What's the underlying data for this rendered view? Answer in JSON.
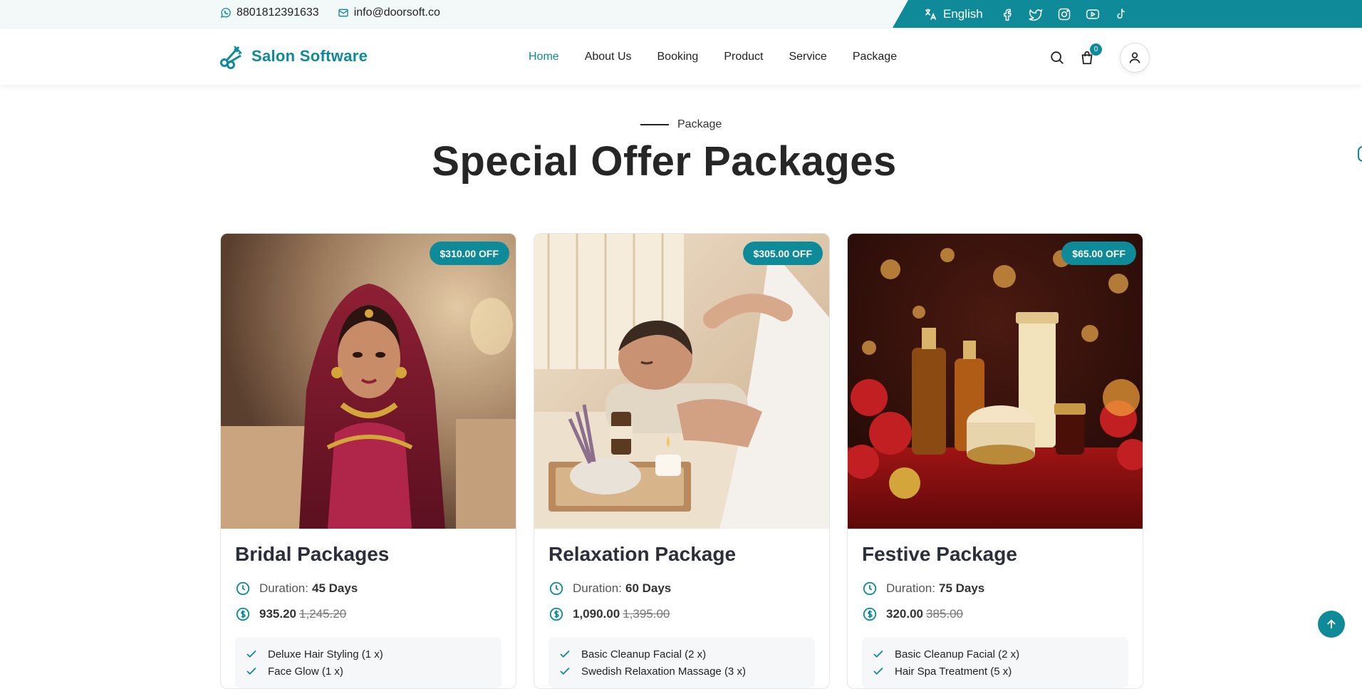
{
  "topbar": {
    "phone": "8801812391633",
    "email": "info@doorsoft.co",
    "language": "English",
    "social_icons": [
      "facebook-icon",
      "twitter-icon",
      "instagram-icon",
      "youtube-icon",
      "tiktok-icon"
    ]
  },
  "header": {
    "logo_text": "Salon Software",
    "nav": [
      {
        "label": "Home",
        "active": true
      },
      {
        "label": "About Us",
        "active": false
      },
      {
        "label": "Booking",
        "active": false
      },
      {
        "label": "Product",
        "active": false
      },
      {
        "label": "Service",
        "active": false
      },
      {
        "label": "Package",
        "active": false
      }
    ],
    "cart_count": "0"
  },
  "section": {
    "label": "Package",
    "title": "Special Offer Packages"
  },
  "packages": [
    {
      "title": "Bridal Packages",
      "badge": "$310.00 OFF",
      "duration_label": "Duration:",
      "duration": "45 Days",
      "price": "935.20",
      "old_price": "1,245.20",
      "features": [
        "Deluxe Hair Styling (1 x)",
        "Face Glow (1 x)"
      ]
    },
    {
      "title": "Relaxation Package",
      "badge": "$305.00 OFF",
      "duration_label": "Duration:",
      "duration": "60 Days",
      "price": "1,090.00",
      "old_price": "1,395.00",
      "features": [
        "Basic Cleanup Facial (2 x)",
        "Swedish Relaxation Massage (3 x)"
      ]
    },
    {
      "title": "Festive Package",
      "badge": "$65.00 OFF",
      "duration_label": "Duration:",
      "duration": "75 Days",
      "price": "320.00",
      "old_price": "385.00",
      "features": [
        "Basic Cleanup Facial (2 x)",
        "Hair Spa Treatment (5 x)"
      ]
    }
  ],
  "colors": {
    "accent": "#0e8a98",
    "title": "#262626"
  }
}
